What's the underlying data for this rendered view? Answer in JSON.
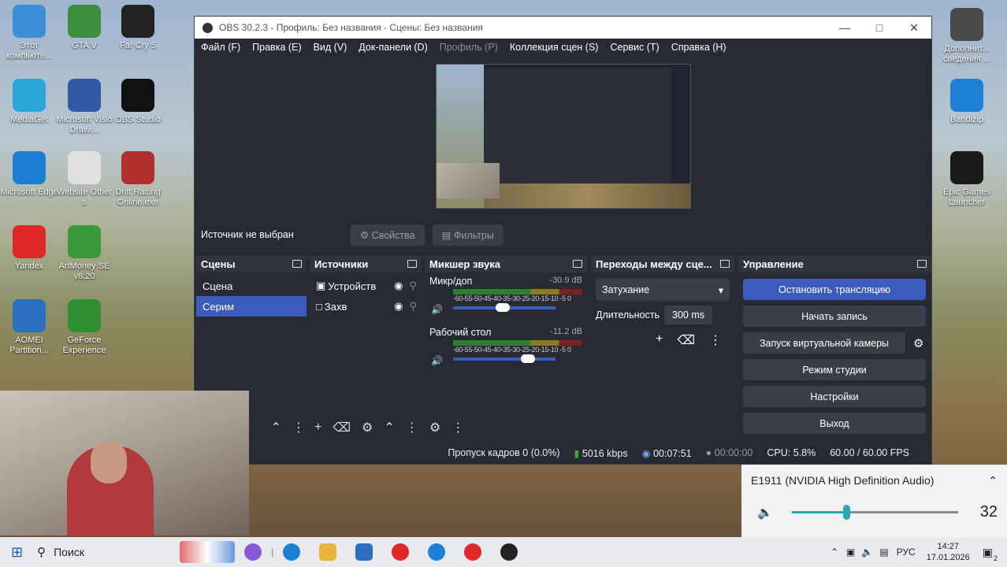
{
  "desktop": {
    "icons": [
      {
        "label": "Этот компьюте...",
        "color": "#3b8fd6"
      },
      {
        "label": "GTA V",
        "color": "#3d8f3d"
      },
      {
        "label": "Far Cry 5",
        "color": "#222222"
      },
      {
        "label": "MediaGet",
        "color": "#2aa7d8"
      },
      {
        "label": "Microsoft Visio Drawi...",
        "color": "#2f5aa8"
      },
      {
        "label": "OBS Studio",
        "color": "#111111"
      },
      {
        "label": "Microsoft Edge",
        "color": "#1b7fd1"
      },
      {
        "label": "Website Other s",
        "color": "#e0e0e0"
      },
      {
        "label": "Drift Racing Online.exe",
        "color": "#b03030"
      },
      {
        "label": "Yandex",
        "color": "#e02828"
      },
      {
        "label": "ArtMoney SE v8.20",
        "color": "#3a9a3a"
      },
      {
        "label": "AOMEI Partition...",
        "color": "#2a6fc0"
      },
      {
        "label": "GeForce Experience",
        "color": "#2f8f2f"
      },
      {
        "label": "Дополнит... сведения ...",
        "color": "#4a4a4a"
      },
      {
        "label": "Bandizip",
        "color": "#1e7fd6"
      },
      {
        "label": "Epic Games Launcher",
        "color": "#1a1a1a"
      }
    ]
  },
  "obs": {
    "title": "OBS 30.2.3 - Профиль: Без названия - Сцены: Без названия",
    "menu": [
      "Файл (F)",
      "Правка (E)",
      "Вид (V)",
      "Док-панели (D)",
      "Профиль (P)",
      "Коллекция сцен (S)",
      "Сервис (T)",
      "Справка (H)"
    ],
    "source_bar": {
      "label": "Источник не выбран",
      "properties": "Свойства",
      "filters": "Фильтры"
    },
    "scenes": {
      "title": "Сцены",
      "items": [
        "Сцена",
        "Серим"
      ]
    },
    "sources": {
      "title": "Источники",
      "items": [
        "Устройств",
        "Захв"
      ]
    },
    "mixer": {
      "title": "Микшер звука",
      "channels": [
        {
          "name": "Микр/доп",
          "db": "-30.9 dB",
          "level": 0.48
        },
        {
          "name": "Рабочий стол",
          "db": "-11.2 dB",
          "level": 0.77
        }
      ],
      "scale": "-60-55-50-45-40-35-30-25-20-15-10 -5  0"
    },
    "transitions": {
      "title": "Переходы между сце...",
      "type": "Затухание",
      "duration_label": "Длительность",
      "duration": "300 ms"
    },
    "controls": {
      "title": "Управление",
      "buttons": [
        "Остановить трансляцию",
        "Начать запись",
        "Запуск виртуальной камеры",
        "Режим студии",
        "Настройки",
        "Выход"
      ]
    },
    "status": {
      "dropped": "Пропуск кадров 0 (0.0%)",
      "kbps": "5016 kbps",
      "stream_time": "00:07:51",
      "rec_time": "00:00:00",
      "cpu": "CPU: 5.8%",
      "fps": "60.00 / 60.00 FPS"
    }
  },
  "volume_flyout": {
    "device": "E1911 (NVIDIA High Definition Audio)",
    "value": "32",
    "level": 0.32
  },
  "taskbar": {
    "search": "Поиск",
    "lang": "РУС",
    "time": "14:27",
    "date": "17.01.2026",
    "notif": "2"
  }
}
